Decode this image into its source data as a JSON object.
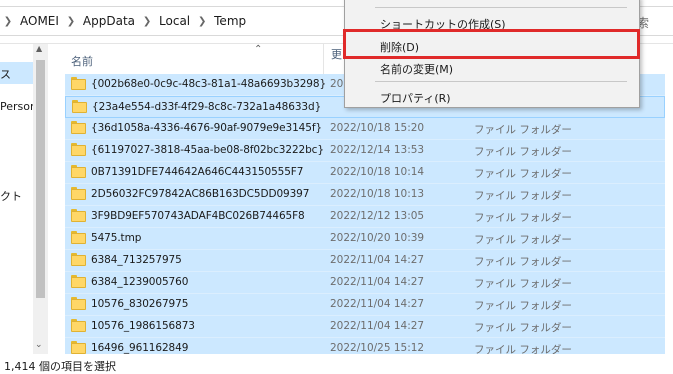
{
  "address": {
    "crumbs": [
      "AOMEI",
      "AppData",
      "Local",
      "Temp"
    ]
  },
  "search": {
    "placeholder_fragment": "索"
  },
  "nav": {
    "items": [
      {
        "label": "ス",
        "selected": true
      },
      {
        "label": "Person",
        "selected": false
      },
      {
        "label": "クト",
        "selected": false
      }
    ]
  },
  "columns": {
    "name": "名前",
    "date_fragment": "更"
  },
  "files": [
    {
      "name": "{002b68e0-0c9c-48c3-81a1-48a6693b3298}",
      "date": "20",
      "type": ""
    },
    {
      "name": "{23a4e554-d33f-4f29-8c8c-732a1a48633d}",
      "date": "",
      "type": ""
    },
    {
      "name": "{36d1058a-4336-4676-90af-9079e9e3145f}",
      "date": "2022/10/18 15:20",
      "type": "ファイル フォルダー"
    },
    {
      "name": "{61197027-3818-45aa-be08-8f02bc3222bc}",
      "date": "2022/12/14 13:53",
      "type": "ファイル フォルダー"
    },
    {
      "name": "0B71391DFE744642A646C443150555F7",
      "date": "2022/10/18 10:14",
      "type": "ファイル フォルダー"
    },
    {
      "name": "2D56032FC97842AC86B163DC5DD09397",
      "date": "2022/10/18 10:13",
      "type": "ファイル フォルダー"
    },
    {
      "name": "3F9BD9EF570743ADAF4BC026B74465F8",
      "date": "2022/12/12 13:05",
      "type": "ファイル フォルダー"
    },
    {
      "name": "5475.tmp",
      "date": "2022/10/20 10:39",
      "type": "ファイル フォルダー"
    },
    {
      "name": "6384_713257975",
      "date": "2022/11/04 14:27",
      "type": "ファイル フォルダー"
    },
    {
      "name": "6384_1239005760",
      "date": "2022/11/04 14:27",
      "type": "ファイル フォルダー"
    },
    {
      "name": "10576_830267975",
      "date": "2022/11/04 14:27",
      "type": "ファイル フォルダー"
    },
    {
      "name": "10576_1986156873",
      "date": "2022/11/04 14:27",
      "type": "ファイル フォルダー"
    },
    {
      "name": "16496_961162849",
      "date": "2022/10/25 15:12",
      "type": "ファイル フォルダー"
    }
  ],
  "status": {
    "text": "1,414 個の項目を選択"
  },
  "context_menu": {
    "items": [
      {
        "label": "ショートカットの作成(S)"
      },
      {
        "label": "削除(D)",
        "highlighted": true
      },
      {
        "label": "名前の変更(M)"
      },
      {
        "label": "プロパティ(R)"
      }
    ]
  },
  "colors": {
    "selection": "#cce8ff",
    "highlight_box": "#e02a2a",
    "folder": "#ffd767"
  }
}
